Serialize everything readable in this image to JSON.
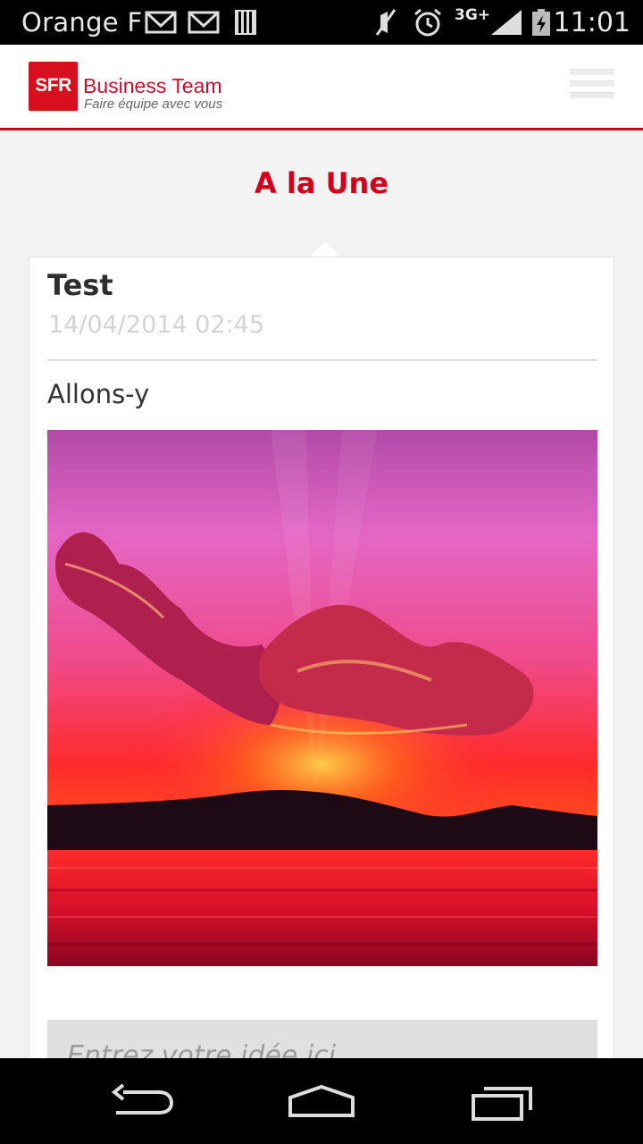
{
  "status_bar": {
    "carrier": "Orange F",
    "network": "3G+",
    "time": "11:01",
    "icons": [
      "gmail-icon",
      "gmail-icon",
      "sim-card-icon",
      "mute-icon",
      "alarm-icon",
      "signal-icon",
      "battery-charging-icon"
    ]
  },
  "header": {
    "logo_badge": "SFR",
    "app_title": "Business Team",
    "tagline": "Faire équipe avec vous",
    "menu_icon": "hamburger-menu-icon"
  },
  "section": {
    "title": "A la Une"
  },
  "post": {
    "title": "Test",
    "date": "14/04/2014 02:45",
    "body": "Allons-y",
    "image": "sunset-over-lake"
  },
  "idea": {
    "placeholder": "Entrez votre idée ici"
  },
  "nav": {
    "icons": [
      "back-icon",
      "home-icon",
      "recent-apps-icon"
    ]
  },
  "colors": {
    "brand_red": "#d0021b",
    "background": "#f3f3f3",
    "card": "#ffffff"
  }
}
